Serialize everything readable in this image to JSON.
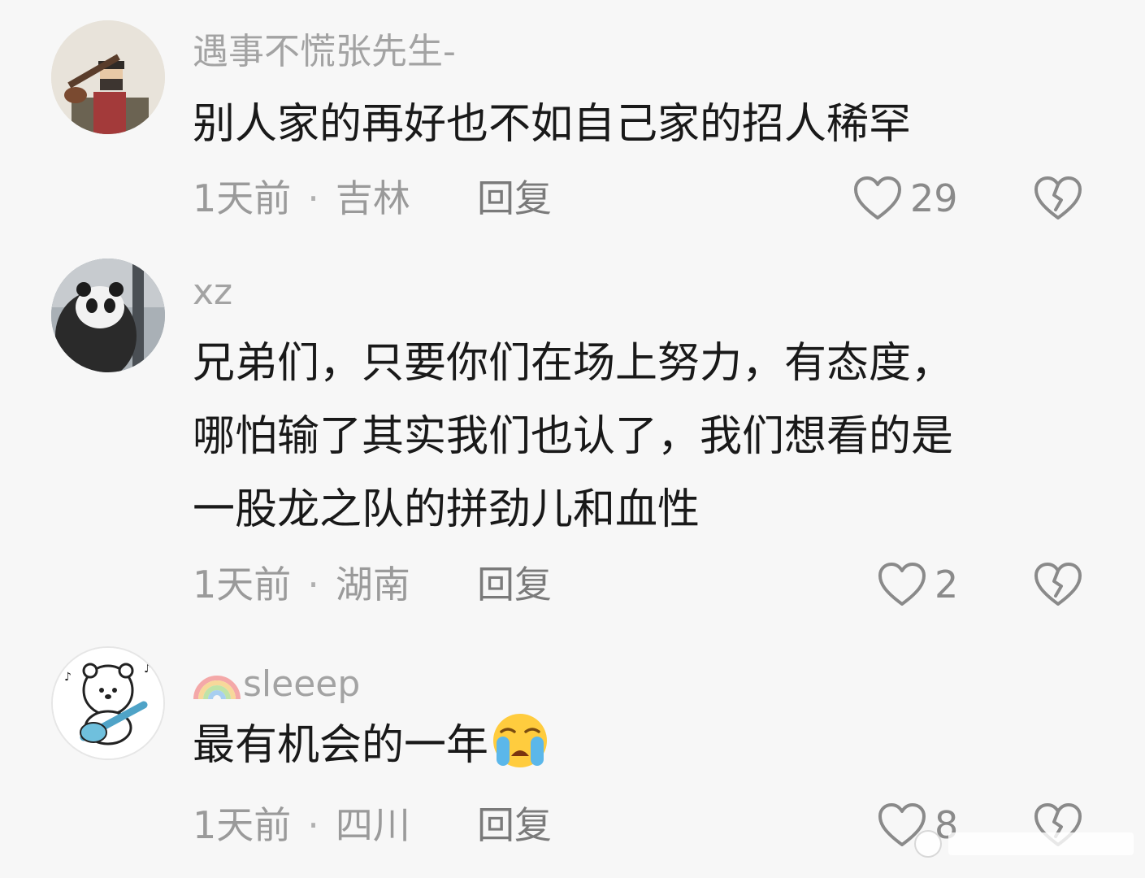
{
  "comments": [
    {
      "username": "遇事不慌张先生-",
      "content_lines": [
        "别人家的再好也不如自己家的招人稀罕"
      ],
      "time": "1天前",
      "location": "吉林",
      "reply_label": "回复",
      "likes": "29",
      "avatar_icon": "man-with-guitar-avatar"
    },
    {
      "username": "xz",
      "content_lines": [
        "兄弟们，只要你们在场上努力，有态度，",
        "哪怕输了其实我们也认了，我们想看的是",
        "一股龙之队的拼劲儿和血性"
      ],
      "time": "1天前",
      "location": "湖南",
      "reply_label": "回复",
      "likes": "2",
      "avatar_icon": "panda-avatar"
    },
    {
      "username": "sleeep",
      "content_lines": [
        "最有机会的一年"
      ],
      "content_emoji": "crying-face-emoji",
      "time": "1天前",
      "location": "四川",
      "reply_label": "回复",
      "likes": "8",
      "avatar_icon": "bear-with-guitar-avatar"
    }
  ],
  "icons": {
    "like": "heart-outline-icon",
    "dislike": "broken-heart-icon",
    "username_prefix": "rainbow-icon"
  },
  "separator": "·",
  "colors": {
    "background": "#f7f7f7",
    "username": "#a3a3a3",
    "content": "#191919",
    "meta": "#9a9a9a"
  }
}
